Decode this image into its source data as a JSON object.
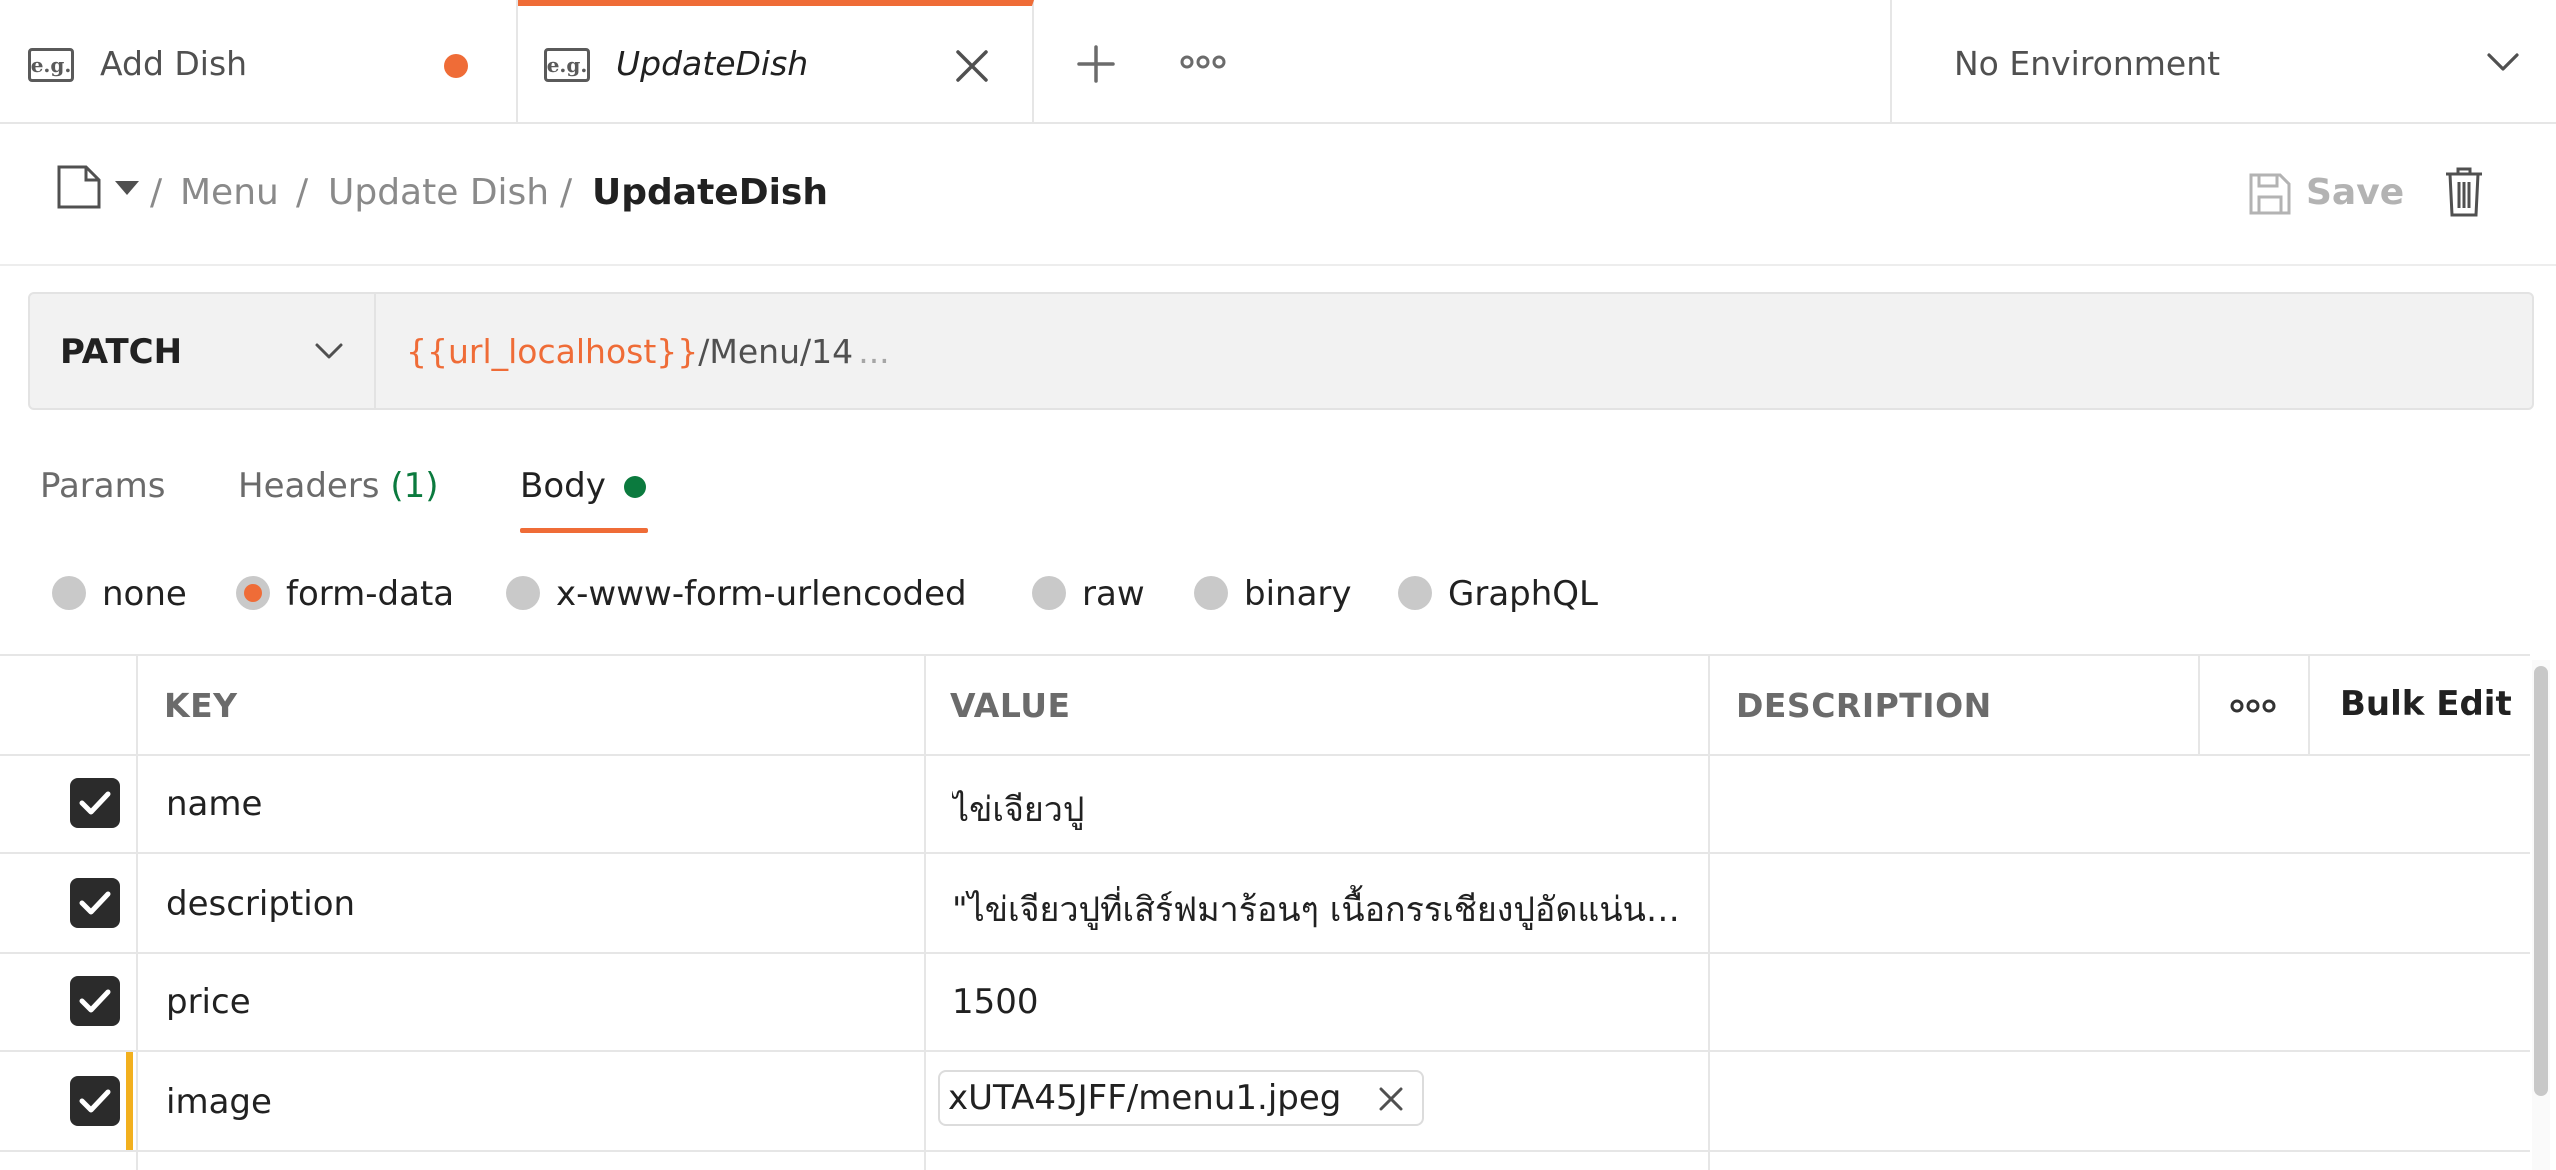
{
  "tabs": [
    {
      "label": "Add Dish",
      "prefix": "e.g.",
      "unsaved": true
    },
    {
      "label": "UpdateDish",
      "prefix": "e.g.",
      "active": true
    }
  ],
  "environment": {
    "selected": "No Environment"
  },
  "breadcrumb": {
    "items": [
      "Menu",
      "Update Dish"
    ],
    "current": "UpdateDish",
    "separator": "/"
  },
  "toolbar": {
    "save_label": "Save"
  },
  "request": {
    "method": "PATCH",
    "url_variable": "{{url_localhost}}",
    "url_path": "/Menu/14",
    "url_ellipsis": "..."
  },
  "request_tabs": [
    {
      "label": "Params"
    },
    {
      "label": "Headers",
      "count": "(1)"
    },
    {
      "label": "Body",
      "active": true
    }
  ],
  "body_modes": {
    "selected": "form-data",
    "options": [
      "none",
      "form-data",
      "x-www-form-urlencoded",
      "raw",
      "binary",
      "GraphQL"
    ]
  },
  "form_table": {
    "headers": {
      "key": "KEY",
      "value": "VALUE",
      "description": "DESCRIPTION",
      "bulk_edit": "Bulk Edit"
    },
    "rows": [
      {
        "key": "name",
        "value": "ไข่เจียวปู",
        "checked": true
      },
      {
        "key": "description",
        "value": "\"ไข่เจียวปูที่เสิร์ฟมาร้อนๆ เนื้อกรรเชียงปูอัดแน่นอ...",
        "checked": true
      },
      {
        "key": "price",
        "value": "1500",
        "checked": true
      },
      {
        "key": "image",
        "value": "xUTA45JFF/menu1.jpeg",
        "checked": true,
        "type": "file"
      }
    ]
  },
  "colors": {
    "accent": "#ef6c37",
    "success": "#0b7a3e",
    "modified_marker": "#f2b01e"
  }
}
